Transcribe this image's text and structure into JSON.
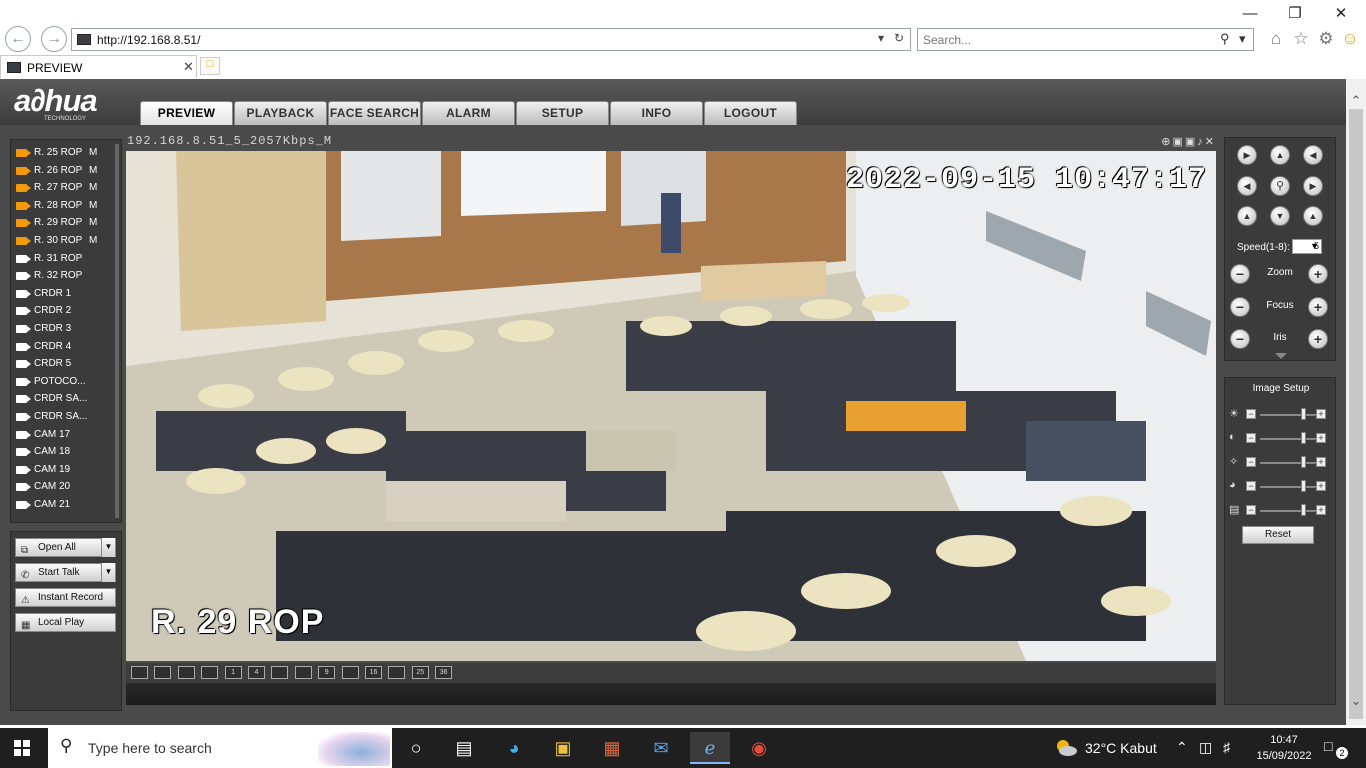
{
  "browser": {
    "url": "http://192.168.8.51/",
    "search_placeholder": "Search...",
    "tab_title": "PREVIEW"
  },
  "app": {
    "logo_text": "a∂hua",
    "logo_sub": "TECHNOLOGY",
    "menu": [
      "PREVIEW",
      "PLAYBACK",
      "FACE SEARCH",
      "ALARM",
      "SETUP",
      "INFO",
      "LOGOUT"
    ],
    "active_menu": "PREVIEW"
  },
  "channels": [
    {
      "name": "R. 25 ROP",
      "status": "M",
      "active": true
    },
    {
      "name": "R. 26 ROP",
      "status": "M",
      "active": true
    },
    {
      "name": "R. 27 ROP",
      "status": "M",
      "active": true
    },
    {
      "name": "R. 28 ROP",
      "status": "M",
      "active": true
    },
    {
      "name": "R. 29 ROP",
      "status": "M",
      "active": true
    },
    {
      "name": "R. 30 ROP",
      "status": "M",
      "active": true
    },
    {
      "name": "R. 31 ROP",
      "status": "",
      "active": false
    },
    {
      "name": "R. 32 ROP",
      "status": "",
      "active": false
    },
    {
      "name": "CRDR 1",
      "status": "",
      "active": false
    },
    {
      "name": "CRDR 2",
      "status": "",
      "active": false
    },
    {
      "name": "CRDR 3",
      "status": "",
      "active": false
    },
    {
      "name": "CRDR 4",
      "status": "",
      "active": false
    },
    {
      "name": "CRDR 5",
      "status": "",
      "active": false
    },
    {
      "name": "POTOCO...",
      "status": "",
      "active": false
    },
    {
      "name": "CRDR SA...",
      "status": "",
      "active": false
    },
    {
      "name": "CRDR SA...",
      "status": "",
      "active": false
    },
    {
      "name": "CAM 17",
      "status": "",
      "active": false
    },
    {
      "name": "CAM 18",
      "status": "",
      "active": false
    },
    {
      "name": "CAM 19",
      "status": "",
      "active": false
    },
    {
      "name": "CAM 20",
      "status": "",
      "active": false
    },
    {
      "name": "CAM 21",
      "status": "",
      "active": false
    }
  ],
  "left_buttons": {
    "open_all": "Open All",
    "start_talk": "Start Talk",
    "instant_record": "Instant Record",
    "local_play": "Local Play"
  },
  "video": {
    "stream_title": "192.168.8.51_5_2057Kbps_M",
    "osd_time": "2022-09-15 10:47:17",
    "osd_name": "R. 29 ROP"
  },
  "layout_buttons": [
    "",
    "",
    "",
    "",
    "1",
    "4",
    "",
    "",
    "9",
    "",
    "16",
    "",
    "25",
    "36"
  ],
  "ptz": {
    "speed_label": "Speed(1-8):",
    "speed_value": "5",
    "zoom_label": "Zoom",
    "focus_label": "Focus",
    "iris_label": "Iris"
  },
  "image_setup": {
    "title": "Image Setup",
    "reset_label": "Reset",
    "sliders": [
      {
        "icon": "brightness-icon",
        "level": 0.75
      },
      {
        "icon": "contrast-icon",
        "level": 0.75
      },
      {
        "icon": "saturation-icon",
        "level": 0.75
      },
      {
        "icon": "hue-icon",
        "level": 0.75
      },
      {
        "icon": "sharpness-icon",
        "level": 0.75
      }
    ]
  },
  "taskbar": {
    "search_placeholder": "Type here to search",
    "weather": "32°C  Kabut",
    "time": "10:47",
    "date": "15/09/2022",
    "notifications": "2"
  }
}
